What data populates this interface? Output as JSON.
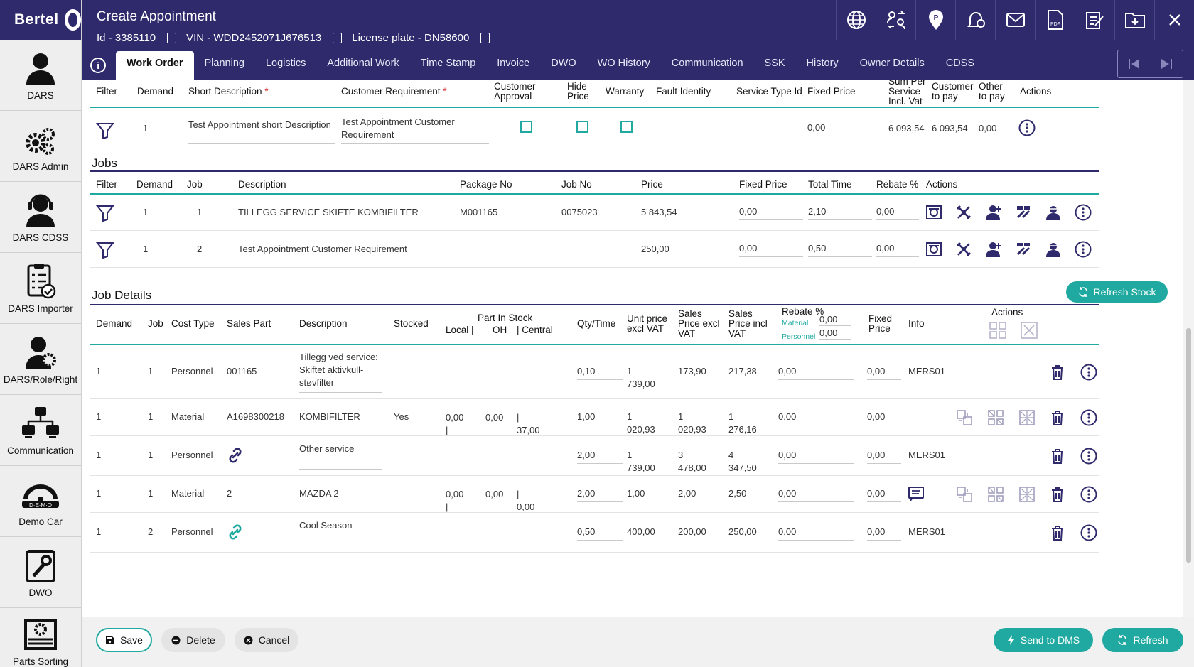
{
  "brand": {
    "name": "Bertel"
  },
  "sidebar": {
    "items": [
      {
        "label": "DARS",
        "icon": "person-icon"
      },
      {
        "label": "DARS Admin",
        "icon": "gears-icon"
      },
      {
        "label": "DARS CDSS",
        "icon": "headset-icon"
      },
      {
        "label": "DARS Importer",
        "icon": "checklist-icon"
      },
      {
        "label": "DARS/Role/Right",
        "icon": "user-gear-icon"
      },
      {
        "label": "Communication",
        "icon": "network-icon"
      },
      {
        "label": "Demo Car",
        "icon": "car-icon"
      },
      {
        "label": "DWO",
        "icon": "wrench-icon"
      },
      {
        "label": "Parts Sorting",
        "icon": "parts-icon"
      }
    ]
  },
  "header": {
    "title": "Create Appointment",
    "id_text": "Id - 3385110",
    "vin_text": "VIN - WDD2452071J676513",
    "plate_text": "License plate - DN58600",
    "icons": [
      "globe-icon",
      "people-swap-icon",
      "map-pin-icon",
      "alarm-icon",
      "mail-icon",
      "pdf-icon",
      "edit-note-icon",
      "folder-download-icon",
      "close-icon"
    ]
  },
  "tabs": [
    "Work Order",
    "Planning",
    "Logistics",
    "Additional Work",
    "Time Stamp",
    "Invoice",
    "DWO",
    "WO History",
    "Communication",
    "SSK",
    "History",
    "Owner Details",
    "CDSS"
  ],
  "demand_table": {
    "headers": {
      "filter": "Filter",
      "demand": "Demand",
      "short_desc": "Short Description",
      "req_star": "*",
      "cust_req": "Customer Requirement",
      "approval_1": "Customer",
      "approval_2": "Approval",
      "hide_1": "Hide",
      "hide_2": "Price",
      "warranty": "Warranty",
      "fault": "Fault Identity",
      "service_type": "Service Type Id",
      "fixed_price": "Fixed Price",
      "sum_1": "Sum Per",
      "sum_2": "Service",
      "sum_3": "Incl. Vat",
      "cust_pay_1": "Customer",
      "cust_pay_2": "to pay",
      "other_pay_1": "Other",
      "other_pay_2": "to pay",
      "actions": "Actions"
    },
    "row": {
      "demand": "1",
      "short_desc": "Test Appointment short Description",
      "cust_req_1": "Test Appointment Customer",
      "cust_req_2": "Requirement",
      "fixed_price": "0,00",
      "sum": "6 093,54",
      "cust_pay": "6 093,54",
      "other_pay": "0,00"
    }
  },
  "jobs": {
    "title": "Jobs",
    "headers": {
      "filter": "Filter",
      "demand": "Demand",
      "job": "Job",
      "description": "Description",
      "package": "Package No",
      "job_no": "Job No",
      "price": "Price",
      "fixed": "Fixed Price",
      "total": "Total Time",
      "rebate": "Rebate %",
      "actions": "Actions"
    },
    "rows": [
      {
        "demand": "1",
        "job": "1",
        "description": "TILLEGG SERVICE SKIFTE KOMBIFILTER",
        "package": "M001165",
        "job_no": "0075023",
        "price": "5 843,54",
        "fixed": "0,00",
        "total": "2,10",
        "rebate": "0,00"
      },
      {
        "demand": "1",
        "job": "2",
        "description": "Test Appointment Customer Requirement",
        "package": "",
        "job_no": "",
        "price": "250,00",
        "fixed": "0,00",
        "total": "0,50",
        "rebate": "0,00"
      }
    ]
  },
  "job_details": {
    "title": "Job Details",
    "refresh_stock": "Refresh Stock",
    "headers": {
      "demand": "Demand",
      "job": "Job",
      "cost_type": "Cost Type",
      "sales_part": "Sales Part",
      "description": "Description",
      "stocked": "Stocked",
      "part_in_stock": "Part In Stock",
      "local": "Local |",
      "oh": "OH",
      "central": "| Central",
      "qty": "Qty/Time",
      "unit_1": "Unit price",
      "unit_2": "excl VAT",
      "sales_ex_1": "Sales",
      "sales_ex_2": "Price excl",
      "sales_ex_3": "VAT",
      "sales_in_1": "Sales",
      "sales_in_2": "Price incl",
      "sales_in_3": "VAT",
      "rebate": "Rebate %",
      "material": "Material",
      "material_val": "0,00",
      "personnel": "Personnel",
      "personnel_val": "0,00",
      "fixed_1": "Fixed",
      "fixed_2": "Price",
      "info": "Info",
      "actions": "Actions"
    },
    "rows": [
      {
        "demand": "1",
        "job": "1",
        "cost_type": "Personnel",
        "sales_part": "001165",
        "desc_1": "Tillegg ved service:",
        "desc_2": "Skiftet aktivkull-",
        "desc_3": "støvfilter",
        "stocked": "",
        "local": "",
        "oh": "",
        "central": "",
        "qty": "0,10",
        "unit": "1 739,00",
        "sales_ex": "173,90",
        "sales_in": "217,38",
        "rebate": "0,00",
        "fixed": "0,00",
        "info": "MERS01"
      },
      {
        "demand": "1",
        "job": "1",
        "cost_type": "Material",
        "sales_part": "A1698300218",
        "desc_1": "KOMBIFILTER",
        "desc_2": "",
        "desc_3": "",
        "stocked": "Yes",
        "local": "0,00 |",
        "oh": "0,00",
        "central": "| 37,00",
        "qty": "1,00",
        "unit": "1 020,93",
        "sales_ex": "1 020,93",
        "sales_in": "1 276,16",
        "rebate": "0,00",
        "fixed": "0,00",
        "info": ""
      },
      {
        "demand": "1",
        "job": "1",
        "cost_type": "Personnel",
        "sales_part": "",
        "desc_1": "Other service",
        "desc_2": "",
        "desc_3": "",
        "stocked": "",
        "local": "",
        "oh": "",
        "central": "",
        "qty": "2,00",
        "unit": "1 739,00",
        "sales_ex": "3 478,00",
        "sales_in": "4 347,50",
        "rebate": "0,00",
        "fixed": "0,00",
        "info": "MERS01"
      },
      {
        "demand": "1",
        "job": "1",
        "cost_type": "Material",
        "sales_part": "2",
        "desc_1": "MAZDA 2",
        "desc_2": "",
        "desc_3": "",
        "stocked": "",
        "local": "0,00 |",
        "oh": "0,00",
        "central": "| 0,00",
        "qty": "2,00",
        "unit": "1,00",
        "sales_ex": "2,00",
        "sales_in": "2,50",
        "rebate": "0,00",
        "fixed": "0,00",
        "info": ""
      },
      {
        "demand": "1",
        "job": "2",
        "cost_type": "Personnel",
        "sales_part": "",
        "desc_1": "Cool Season",
        "desc_2": "",
        "desc_3": "",
        "stocked": "",
        "local": "",
        "oh": "",
        "central": "",
        "qty": "0,50",
        "unit": "400,00",
        "sales_ex": "200,00",
        "sales_in": "250,00",
        "rebate": "0,00",
        "fixed": "0,00",
        "info": "MERS01"
      }
    ]
  },
  "footer": {
    "save": "Save",
    "delete": "Delete",
    "cancel": "Cancel",
    "send_dms": "Send to DMS",
    "refresh": "Refresh"
  },
  "colors": {
    "navy": "#2e2a6c",
    "teal": "#1fa9a0",
    "required": "#d32f2f"
  }
}
